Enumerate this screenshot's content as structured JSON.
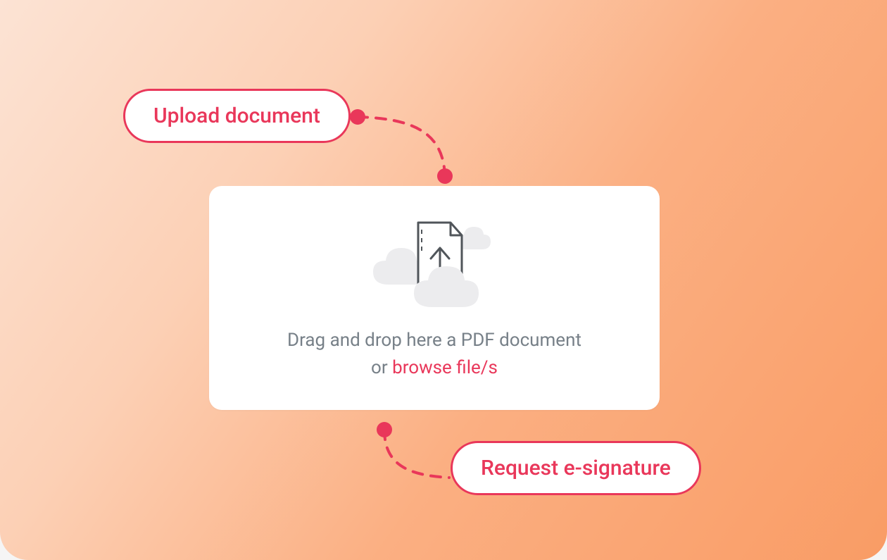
{
  "labels": {
    "upload": "Upload document",
    "request": "Request e-signature"
  },
  "dropzone": {
    "line1": "Drag and drop here a PDF document",
    "or": "or ",
    "browse": "browse file/s"
  },
  "colors": {
    "accent": "#e9375a",
    "muted": "#778088"
  }
}
